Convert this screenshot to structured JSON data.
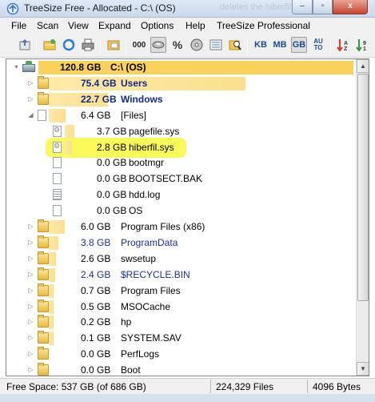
{
  "window": {
    "title": "TreeSize Free - Allocated - C:\\  (OS)",
    "background_title_text": "deletes the hiberfil.sys",
    "controls": {
      "minimize": "–",
      "maximize": "▫",
      "close": "x"
    }
  },
  "menu": [
    "File",
    "Scan",
    "View",
    "Expand",
    "Options",
    "Help",
    "TreeSize Professional"
  ],
  "toolbar": {
    "count_label": "000",
    "percent_label": "%",
    "unit_kb": "KB",
    "unit_mb": "MB",
    "unit_gb": "GB",
    "unit_auto_top": "AU",
    "unit_auto_bottom": "TO",
    "selected_unit": "GB"
  },
  "tree": {
    "rows": [
      {
        "size": "120.8 GB",
        "name": "C:\\  (OS)",
        "type": "drive",
        "bar_fraction": 1.0,
        "bold": true,
        "selected": true,
        "expander": "▾"
      },
      {
        "size": "75.4 GB",
        "name": "Users",
        "type": "folder",
        "bar_fraction": 0.624,
        "bold": true,
        "expander": "▷"
      },
      {
        "size": "22.7 GB",
        "name": "Windows",
        "type": "folder",
        "bar_fraction": 0.188,
        "bold": true,
        "expander": "▷"
      },
      {
        "size": "6.4 GB",
        "name": "[Files]",
        "type": "file",
        "bar_fraction": 0.053,
        "expander": "◢"
      },
      {
        "size": "3.7 GB",
        "name": "pagefile.sys",
        "type": "sys",
        "bar_fraction": 0.031,
        "expander": ""
      },
      {
        "size": "2.8 GB",
        "name": "hiberfil.sys",
        "type": "sys",
        "bar_fraction": 0.023,
        "expander": "",
        "highlighted": true
      },
      {
        "size": "0.0 GB",
        "name": "bootmgr",
        "type": "file",
        "bar_fraction": 0,
        "expander": ""
      },
      {
        "size": "0.0 GB",
        "name": "BOOTSECT.BAK",
        "type": "file",
        "bar_fraction": 0,
        "expander": ""
      },
      {
        "size": "0.0 GB",
        "name": "hdd.log",
        "type": "lines",
        "bar_fraction": 0,
        "expander": ""
      },
      {
        "size": "0.0 GB",
        "name": "OS",
        "type": "file",
        "bar_fraction": 0,
        "expander": ""
      },
      {
        "size": "6.0 GB",
        "name": "Program Files (x86)",
        "type": "folder",
        "bar_fraction": 0.05,
        "expander": "▷"
      },
      {
        "size": "3.8 GB",
        "name": "ProgramData",
        "type": "folder",
        "bar_fraction": 0.031,
        "expander": "▷",
        "color": "blue"
      },
      {
        "size": "2.6 GB",
        "name": "swsetup",
        "type": "folder",
        "bar_fraction": 0.022,
        "expander": "▷"
      },
      {
        "size": "2.4 GB",
        "name": "$RECYCLE.BIN",
        "type": "folder",
        "bar_fraction": 0.02,
        "expander": "▷",
        "color": "blue"
      },
      {
        "size": "0.7 GB",
        "name": "Program Files",
        "type": "folder",
        "bar_fraction": 0.006,
        "expander": "▷"
      },
      {
        "size": "0.5 GB",
        "name": "MSOCache",
        "type": "folder",
        "bar_fraction": 0.004,
        "expander": "▷"
      },
      {
        "size": "0.2 GB",
        "name": "hp",
        "type": "folder",
        "bar_fraction": 0.002,
        "expander": "▷"
      },
      {
        "size": "0.1 GB",
        "name": "SYSTEM.SAV",
        "type": "folder",
        "bar_fraction": 0.001,
        "expander": "▷"
      },
      {
        "size": "0.0 GB",
        "name": "PerfLogs",
        "type": "folder",
        "bar_fraction": 0,
        "expander": "▷"
      },
      {
        "size": "0.0 GB",
        "name": "Boot",
        "type": "folder",
        "bar_fraction": 0,
        "expander": "▷"
      }
    ]
  },
  "status": {
    "free_space": "Free Space: 537 GB  (of 686 GB)",
    "files": "224,329  Files",
    "cluster": "4096 Bytes"
  },
  "colors": {
    "drive_bar": "#fad15a",
    "bar_light": "#fde9a8",
    "highlight": "#f8f83c",
    "blue_text": "#1d2f9c"
  }
}
